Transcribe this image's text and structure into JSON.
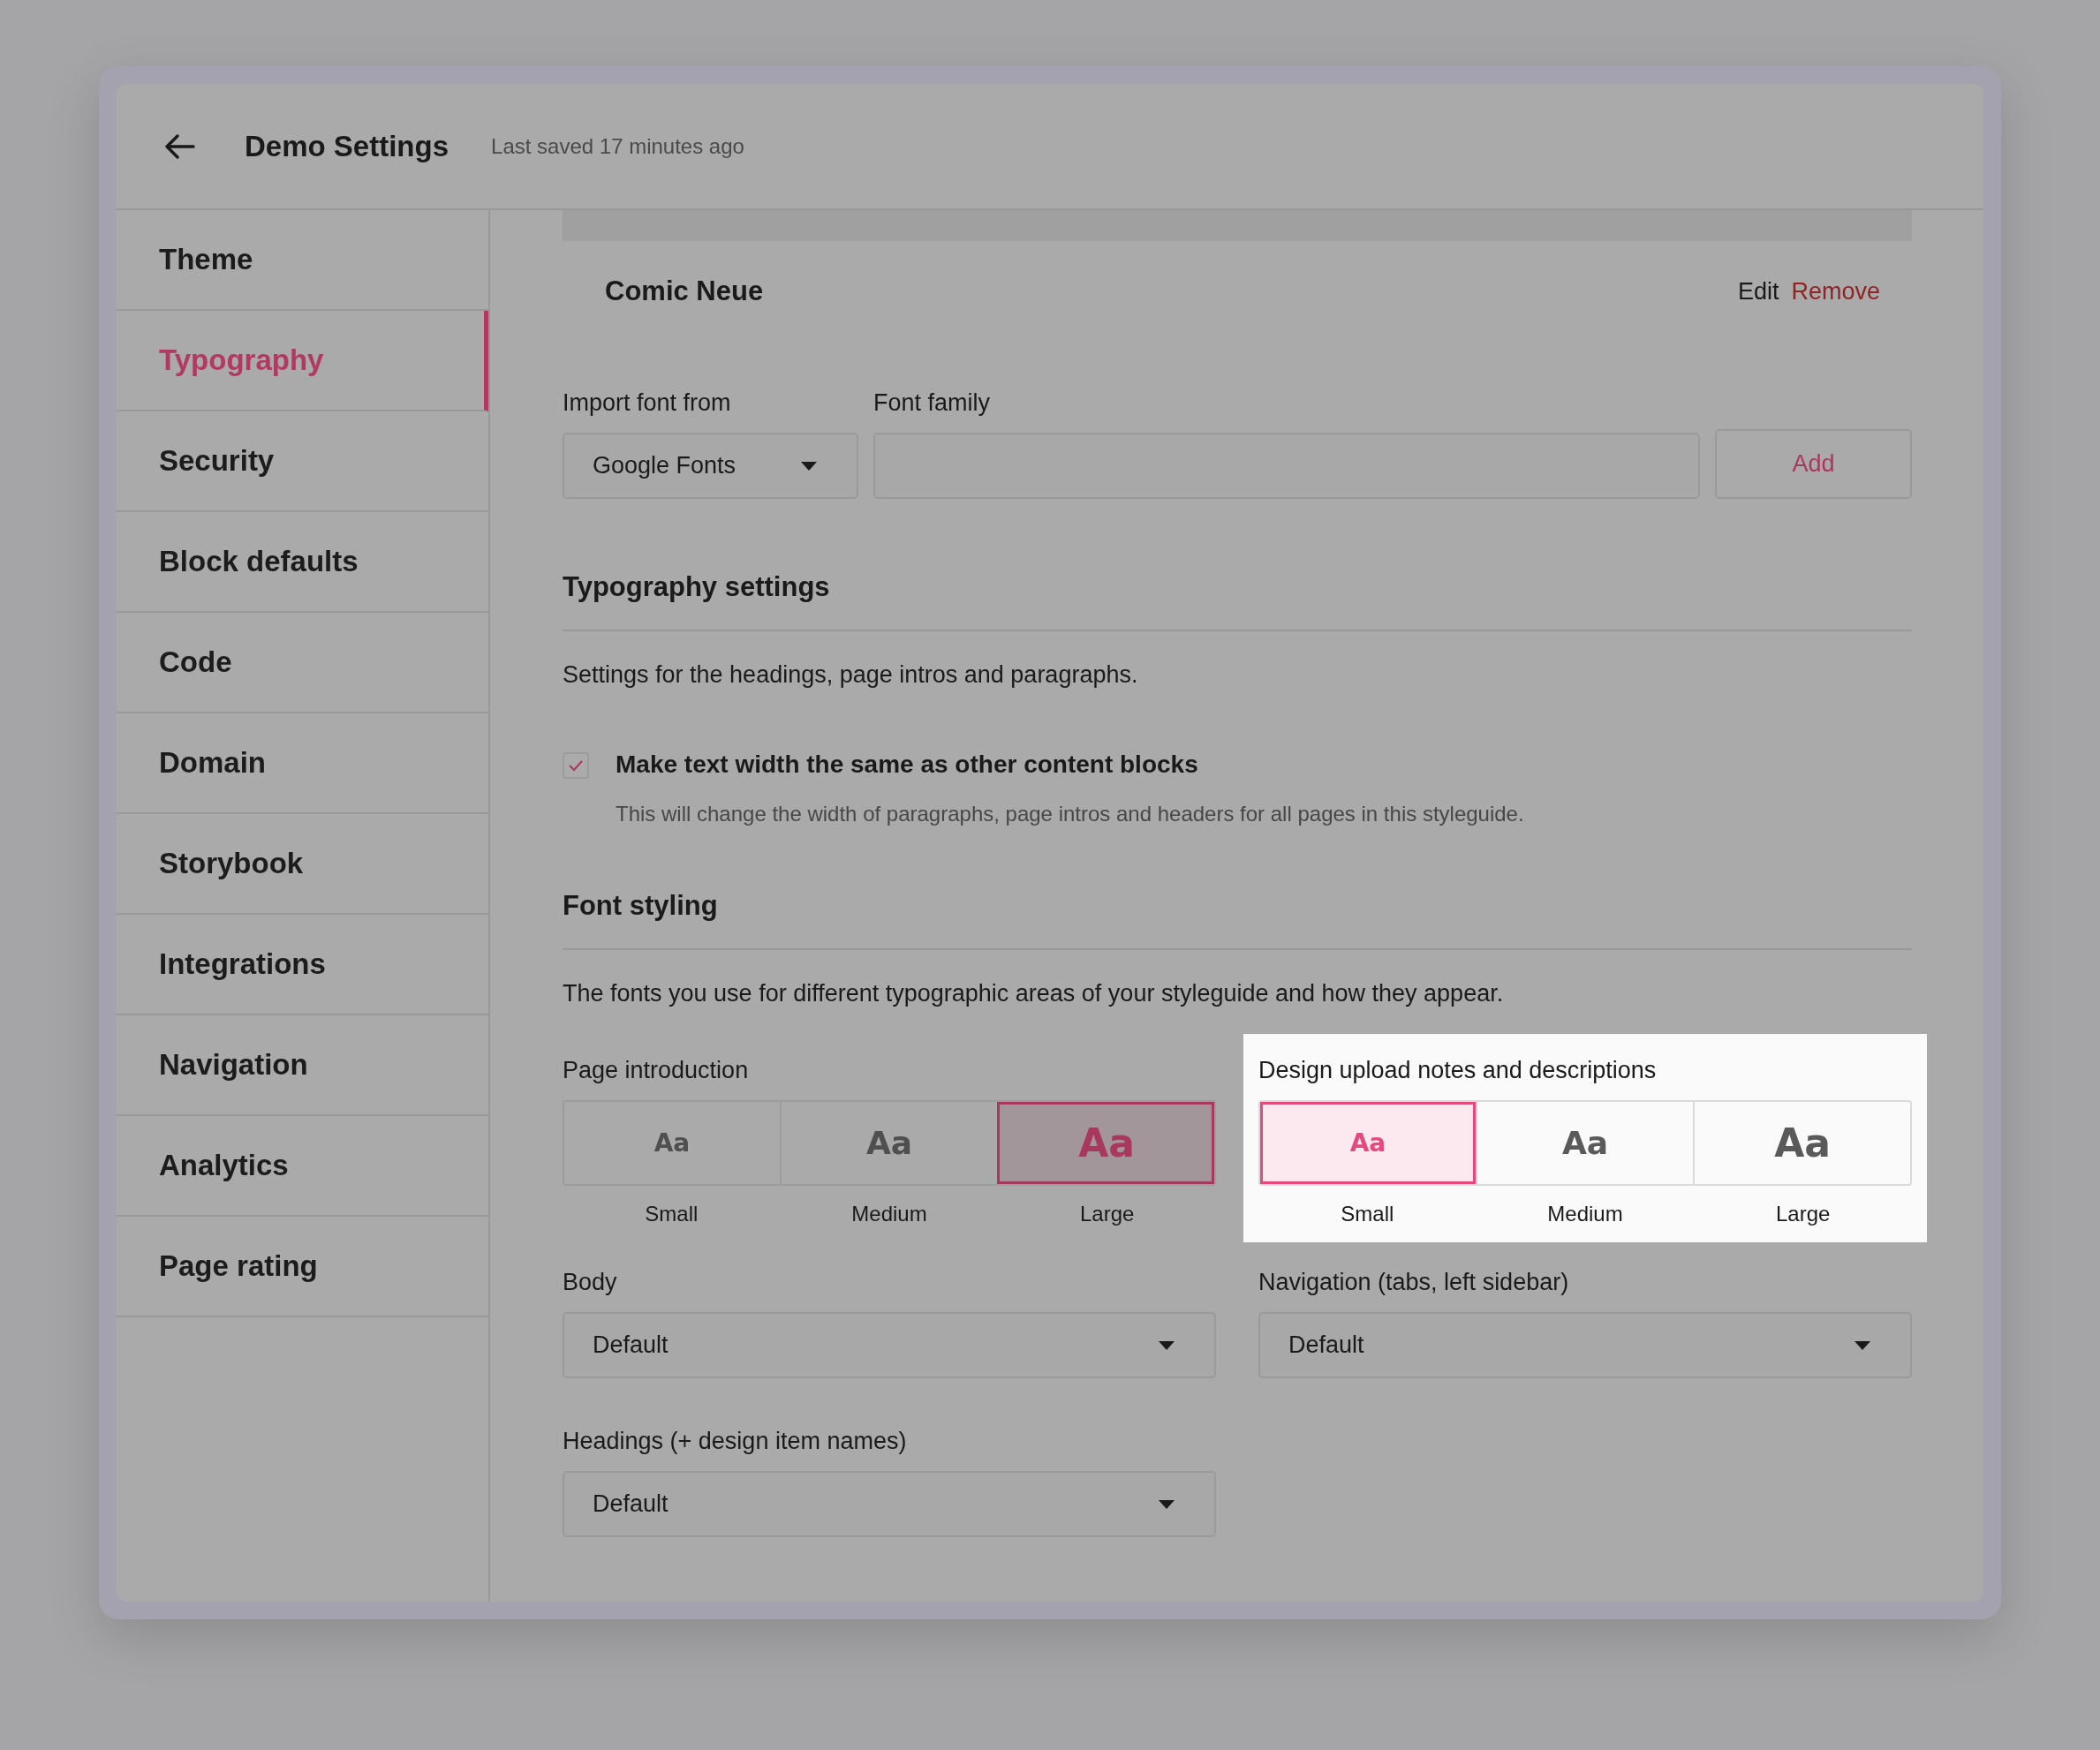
{
  "header": {
    "title": "Demo Settings",
    "status": "Last saved 17 minutes ago"
  },
  "sidebar": {
    "items": [
      {
        "label": "Theme",
        "selected": false
      },
      {
        "label": "Typography",
        "selected": true
      },
      {
        "label": "Security",
        "selected": false
      },
      {
        "label": "Block defaults",
        "selected": false
      },
      {
        "label": "Code",
        "selected": false
      },
      {
        "label": "Domain",
        "selected": false
      },
      {
        "label": "Storybook",
        "selected": false
      },
      {
        "label": "Integrations",
        "selected": false
      },
      {
        "label": "Navigation",
        "selected": false
      },
      {
        "label": "Analytics",
        "selected": false
      },
      {
        "label": "Page rating",
        "selected": false
      }
    ]
  },
  "font_card": {
    "name": "Comic Neue",
    "actions": [
      {
        "label": "Edit",
        "kind": "plain"
      },
      {
        "label": "Remove",
        "kind": "danger"
      }
    ]
  },
  "import": {
    "source_label": "Import font from",
    "source_value": "Google Fonts",
    "family_label": "Font family",
    "add_button": "Add"
  },
  "typography_settings": {
    "title": "Typography settings",
    "description": "Settings for the headings, page intros and paragraphs.",
    "checkbox": {
      "label": "Make text width the same as other content blocks",
      "help": "This will change the width of paragraphs, page intros and headers for all pages in this styleguide.",
      "checked": true
    }
  },
  "font_styling": {
    "title": "Font styling",
    "description": "The fonts you use for different typographic areas of your styleguide and how they appear.",
    "size_groups": [
      {
        "label": "Page introduction",
        "highlighted": false,
        "options": [
          {
            "sample": "Aa",
            "label": "Small",
            "selected": false
          },
          {
            "sample": "Aa",
            "label": "Medium",
            "selected": false
          },
          {
            "sample": "Aa",
            "label": "Large",
            "selected": true
          }
        ]
      },
      {
        "label": "Design upload notes and descriptions",
        "highlighted": true,
        "options": [
          {
            "sample": "Aa",
            "label": "Small",
            "selected": true
          },
          {
            "sample": "Aa",
            "label": "Medium",
            "selected": false
          },
          {
            "sample": "Aa",
            "label": "Large",
            "selected": false
          }
        ]
      }
    ],
    "selects": [
      {
        "label": "Body",
        "value": "Default"
      },
      {
        "label": "Navigation (tabs, left sidebar)",
        "value": "Default"
      },
      {
        "label": "Headings (+ design item names)",
        "value": "Default"
      }
    ]
  }
}
